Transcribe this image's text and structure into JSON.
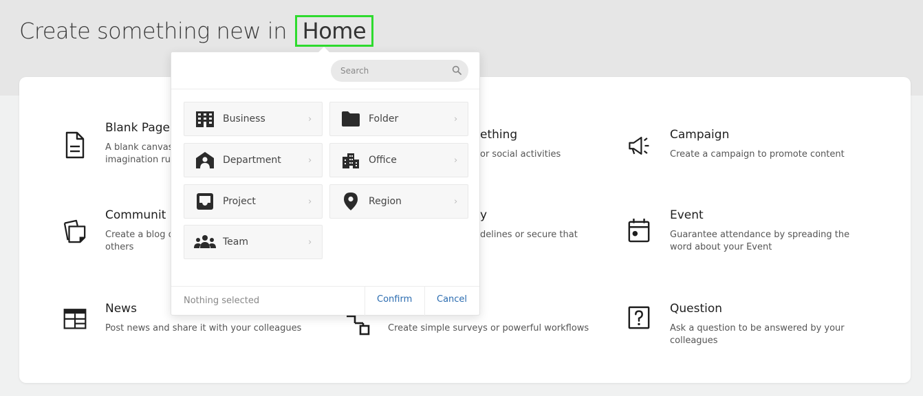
{
  "header": {
    "title_prefix": "Create something new in",
    "location": "Home"
  },
  "options": [
    {
      "key": "blank-page",
      "icon": "document-icon",
      "title": "Blank Page",
      "description": "A blank canvas imagination ru"
    },
    {
      "key": "something",
      "icon": "",
      "title": "ething",
      "description": "or social activities"
    },
    {
      "key": "campaign",
      "icon": "megaphone-icon",
      "title": "Campaign",
      "description": "Create a campaign to promote content"
    },
    {
      "key": "community",
      "icon": "pages-icon",
      "title": "Communit",
      "description": "Create a blog o others"
    },
    {
      "key": "y-item",
      "icon": "",
      "title": "y",
      "description": "delines or secure that"
    },
    {
      "key": "event",
      "icon": "calendar-icon",
      "title": "Event",
      "description": "Guarantee attendance by spreading the word about your Event"
    },
    {
      "key": "news",
      "icon": "newspaper-icon",
      "title": "News",
      "description": "Post news and share it with your colleagues"
    },
    {
      "key": "workflow",
      "icon": "workflow-icon",
      "title": "",
      "description": "Create simple surveys or powerful workflows"
    },
    {
      "key": "question",
      "icon": "question-icon",
      "title": "Question",
      "description": "Ask a question to be answered by your colleagues"
    }
  ],
  "popup": {
    "search_placeholder": "Search",
    "items": [
      {
        "label": "Business",
        "icon": "building-icon"
      },
      {
        "label": "Folder",
        "icon": "folder-icon"
      },
      {
        "label": "Department",
        "icon": "department-icon"
      },
      {
        "label": "Office",
        "icon": "office-icon"
      },
      {
        "label": "Project",
        "icon": "inbox-icon"
      },
      {
        "label": "Region",
        "icon": "location-pin-icon"
      },
      {
        "label": "Team",
        "icon": "team-icon"
      }
    ],
    "status": "Nothing selected",
    "confirm_label": "Confirm",
    "cancel_label": "Cancel"
  },
  "colors": {
    "highlight": "#2edb2e",
    "link": "#2b6cb0"
  }
}
